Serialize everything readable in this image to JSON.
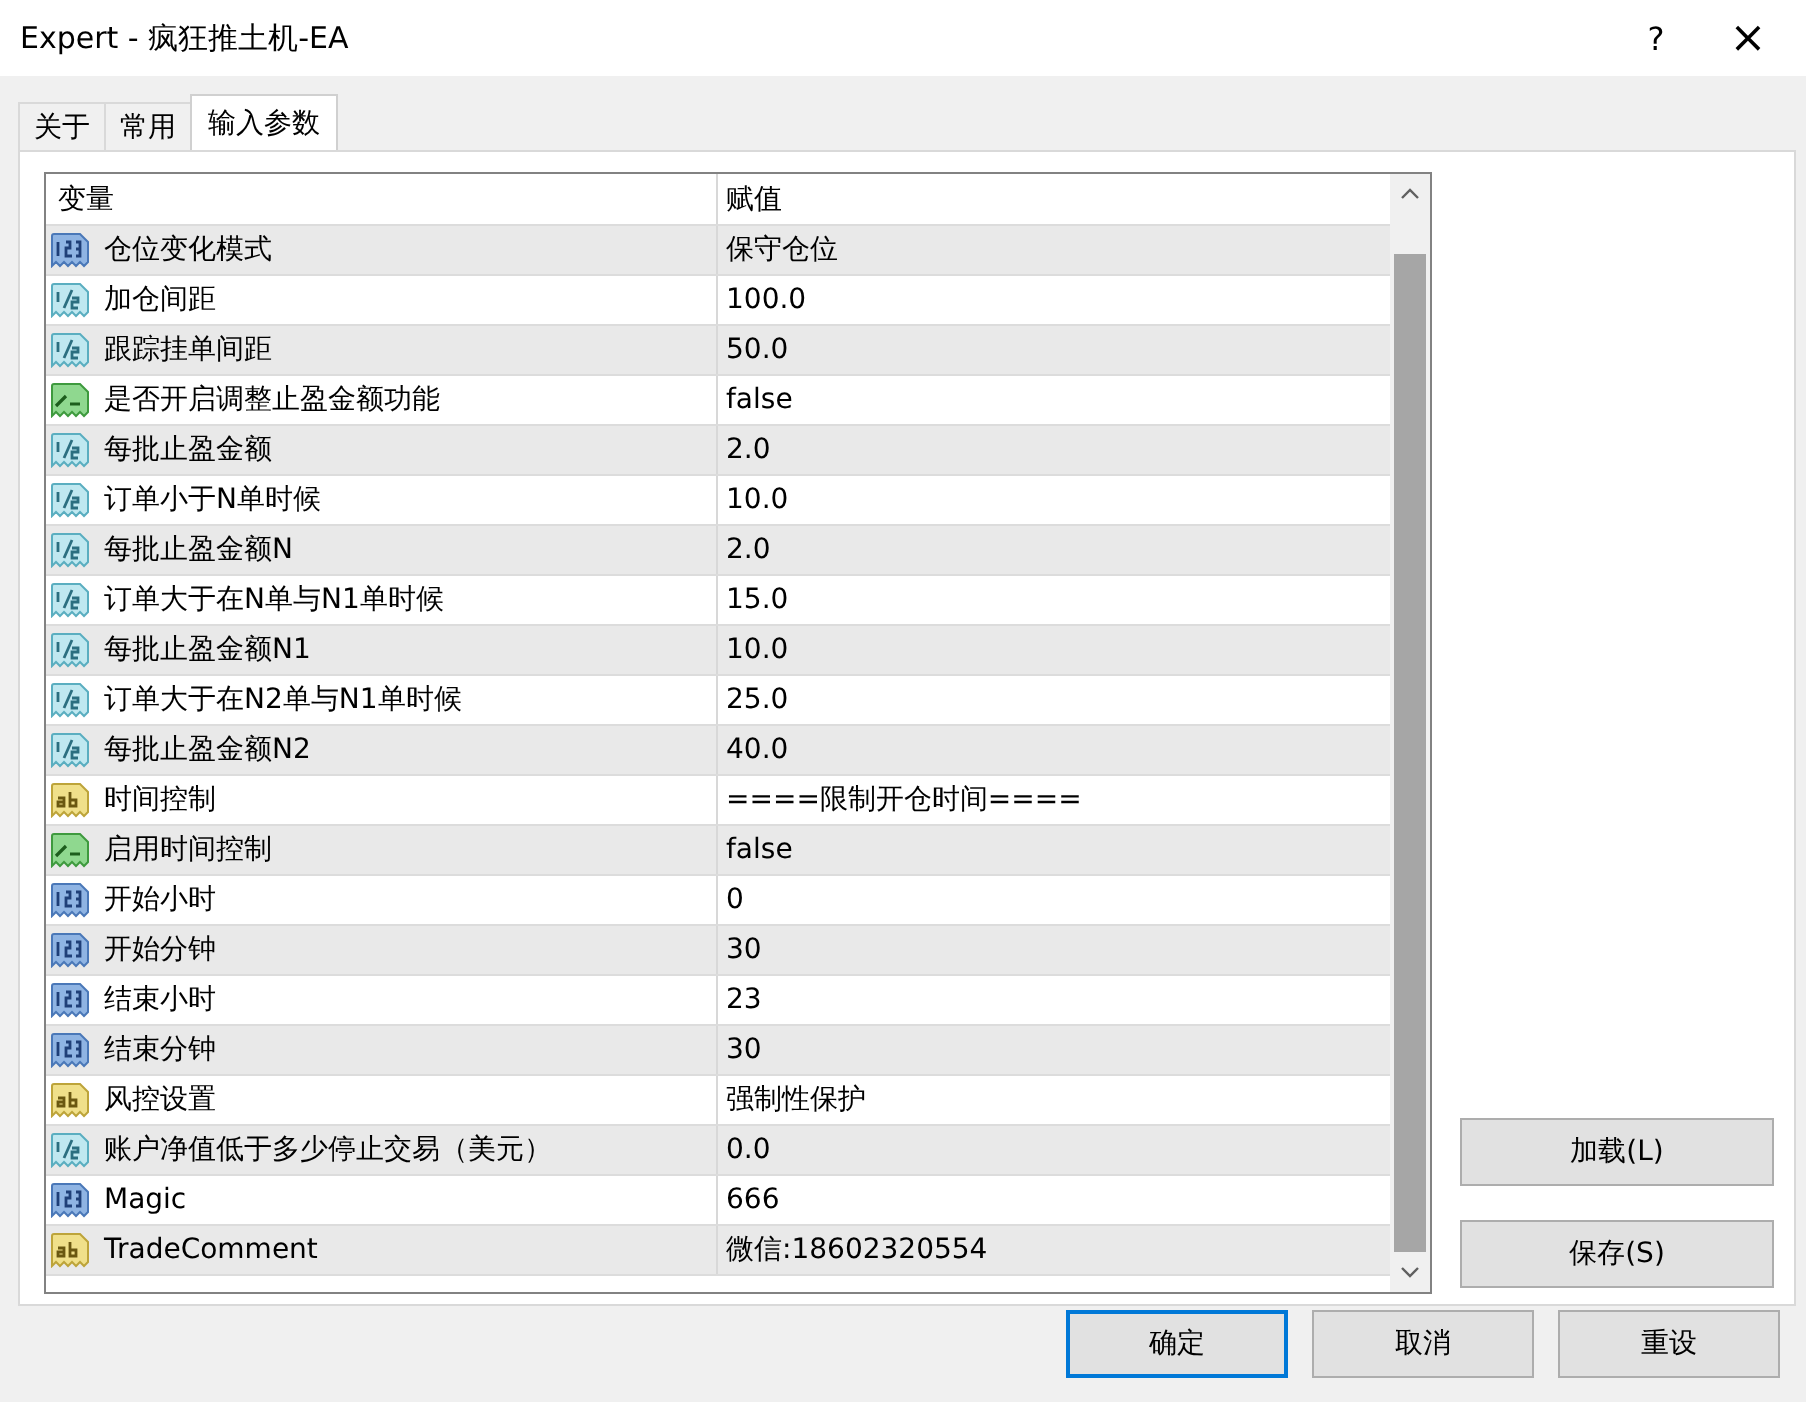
{
  "window": {
    "title": "Expert - 疯狂推土机-EA",
    "help": "?",
    "close": "×"
  },
  "tabs": [
    {
      "label": "关于",
      "selected": false
    },
    {
      "label": "常用",
      "selected": false
    },
    {
      "label": "输入参数",
      "selected": true
    }
  ],
  "table": {
    "columns": [
      "变量",
      "赋值"
    ],
    "rows": [
      {
        "kind": "int",
        "name": "仓位变化模式",
        "value": "保守仓位"
      },
      {
        "kind": "double",
        "name": "加仓间距",
        "value": "100.0"
      },
      {
        "kind": "double",
        "name": "跟踪挂单间距",
        "value": "50.0"
      },
      {
        "kind": "bool",
        "name": "是否开启调整止盈金额功能",
        "value": "false"
      },
      {
        "kind": "double",
        "name": "每批止盈金额",
        "value": "2.0"
      },
      {
        "kind": "double",
        "name": "订单小于N单时候",
        "value": "10.0"
      },
      {
        "kind": "double",
        "name": "每批止盈金额N",
        "value": "2.0"
      },
      {
        "kind": "double",
        "name": "订单大于在N单与N1单时候",
        "value": "15.0"
      },
      {
        "kind": "double",
        "name": "每批止盈金额N1",
        "value": "10.0"
      },
      {
        "kind": "double",
        "name": "订单大于在N2单与N1单时候",
        "value": "25.0"
      },
      {
        "kind": "double",
        "name": "每批止盈金额N2",
        "value": "40.0"
      },
      {
        "kind": "string",
        "name": "时间控制",
        "value": "====限制开仓时间===="
      },
      {
        "kind": "bool",
        "name": "启用时间控制",
        "value": "false"
      },
      {
        "kind": "int",
        "name": "开始小时",
        "value": "0"
      },
      {
        "kind": "int",
        "name": "开始分钟",
        "value": "30"
      },
      {
        "kind": "int",
        "name": "结束小时",
        "value": "23"
      },
      {
        "kind": "int",
        "name": "结束分钟",
        "value": "30"
      },
      {
        "kind": "string",
        "name": "风控设置",
        "value": "强制性保护"
      },
      {
        "kind": "double",
        "name": "账户净值低于多少停止交易（美元）",
        "value": "0.0"
      },
      {
        "kind": "int",
        "name": "Magic",
        "value": "666"
      },
      {
        "kind": "string",
        "name": "TradeComment",
        "value": "微信:18602320554"
      }
    ]
  },
  "side_buttons": [
    "加载(L)",
    "保存(S)"
  ],
  "buttons": [
    {
      "label": "确定",
      "default": true
    },
    {
      "label": "取消",
      "default": false
    },
    {
      "label": "重设",
      "default": false
    }
  ]
}
